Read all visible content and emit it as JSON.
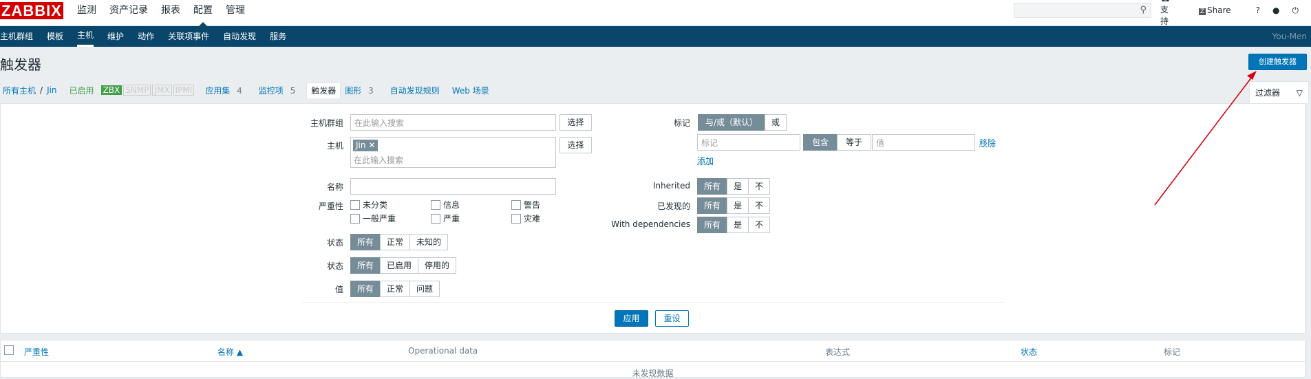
{
  "header": {
    "logo": "ZABBIX",
    "nav": [
      "监测",
      "资产记录",
      "报表",
      "配置",
      "管理"
    ],
    "support": "支持",
    "share": "Share",
    "help": "?",
    "search_icon": "search-icon"
  },
  "subnav": {
    "items": [
      "主机群组",
      "模板",
      "主机",
      "维护",
      "动作",
      "关联项事件",
      "自动发现",
      "服务"
    ],
    "user": "You-Men"
  },
  "page": {
    "title": "触发器",
    "create_button": "创建触发器"
  },
  "breadcrumb": {
    "all_hosts": "所有主机",
    "sep": "/",
    "host": "Jin",
    "enabled": "已启用",
    "zbx": "ZBX",
    "snmp": "SNMP",
    "jmx": "JMX",
    "ipmi": "IPMI",
    "applications": "应用集",
    "applications_count": "4",
    "items": "监控项",
    "items_count": "5",
    "triggers": "触发器",
    "graphs": "图形",
    "graphs_count": "3",
    "discovery": "自动发现规则",
    "web": "Web 场景"
  },
  "filter": {
    "tab_label": "过滤器",
    "host_group_label": "主机群组",
    "host_group_placeholder": "在此输入搜索",
    "select": "选择",
    "host_label": "主机",
    "host_chip": "Jin",
    "host_placeholder": "在此输入搜索",
    "name_label": "名称",
    "severity_label": "严重性",
    "severities": [
      "未分类",
      "信息",
      "警告",
      "一般严重",
      "严重",
      "灾难"
    ],
    "state_label": "状态",
    "state_options": [
      "所有",
      "正常",
      "未知的"
    ],
    "status_label": "状态",
    "status_options": [
      "所有",
      "已启用",
      "停用的"
    ],
    "value_label": "值",
    "value_options": [
      "所有",
      "正常",
      "问题"
    ],
    "tags_label": "标记",
    "tags_mode": [
      "与/或（默认）",
      "或"
    ],
    "tag_placeholder": "标记",
    "tag_ops": [
      "包含",
      "等于"
    ],
    "value_placeholder": "值",
    "remove": "移除",
    "add": "添加",
    "inherited_label": "Inherited",
    "inherited_options": [
      "所有",
      "是",
      "不"
    ],
    "discovered_label": "已发现的",
    "discovered_options": [
      "所有",
      "是",
      "不"
    ],
    "deps_label": "With dependencies",
    "deps_options": [
      "所有",
      "是",
      "不"
    ],
    "apply": "应用",
    "reset": "重设"
  },
  "table": {
    "columns": [
      "严重性",
      "名称 ▲",
      "Operational data",
      "表达式",
      "状态",
      "标记"
    ],
    "empty": "未发现数据"
  }
}
